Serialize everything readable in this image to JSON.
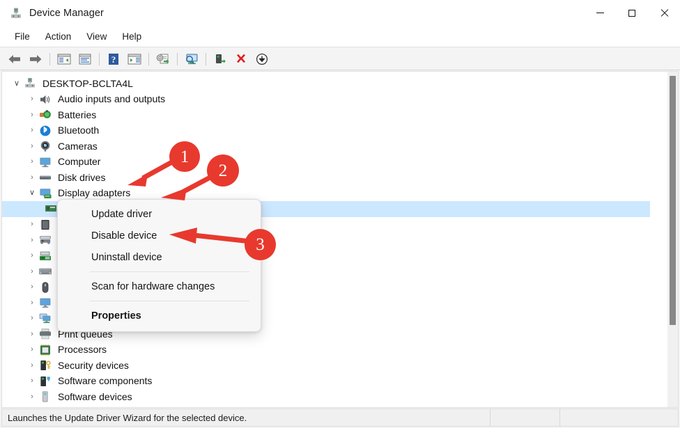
{
  "window": {
    "title": "Device Manager",
    "icon": "device-manager-icon",
    "controls": {
      "minimize": "Minimize",
      "maximize": "Maximize",
      "close": "Close"
    }
  },
  "menubar": {
    "items": [
      {
        "label": "File"
      },
      {
        "label": "Action"
      },
      {
        "label": "View"
      },
      {
        "label": "Help"
      }
    ]
  },
  "toolbar": {
    "buttons": [
      {
        "name": "back-icon",
        "tooltip": "Back"
      },
      {
        "name": "forward-icon",
        "tooltip": "Forward"
      },
      {
        "name": "show-hide-console-tree-icon",
        "tooltip": "Show/Hide console tree"
      },
      {
        "name": "properties-icon",
        "tooltip": "Properties"
      },
      {
        "name": "help-icon",
        "tooltip": "Help"
      },
      {
        "name": "show-hide-action-pane-icon",
        "tooltip": "Show/Hide Action pane"
      },
      {
        "name": "update-driver-icon",
        "tooltip": "Update driver"
      },
      {
        "name": "scan-for-hardware-changes-icon",
        "tooltip": "Scan for hardware changes"
      },
      {
        "name": "enable-device-icon",
        "tooltip": "Enable device"
      },
      {
        "name": "uninstall-device-icon",
        "tooltip": "Uninstall device"
      },
      {
        "name": "disable-device-icon",
        "tooltip": "Disable device"
      }
    ]
  },
  "tree": {
    "root": {
      "label": "DESKTOP-BCLTA4L",
      "icon": "computer-root-icon",
      "expanded": true,
      "chevron": "∨"
    },
    "items": [
      {
        "label": "Audio inputs and outputs",
        "icon": "speaker-icon",
        "expanded": false,
        "selected": false
      },
      {
        "label": "Batteries",
        "icon": "battery-icon",
        "expanded": false,
        "selected": false
      },
      {
        "label": "Bluetooth",
        "icon": "bluetooth-icon",
        "expanded": false,
        "selected": false
      },
      {
        "label": "Cameras",
        "icon": "camera-icon",
        "expanded": false,
        "selected": false
      },
      {
        "label": "Computer",
        "icon": "monitor-icon",
        "expanded": false,
        "selected": false
      },
      {
        "label": "Disk drives",
        "icon": "disk-drive-icon",
        "expanded": false,
        "selected": false
      },
      {
        "label": "Display adapters",
        "icon": "display-adapter-icon",
        "expanded": true,
        "selected": false
      },
      {
        "label": "",
        "icon": "graphics-card-icon",
        "expanded": false,
        "selected": true
      },
      {
        "label": "",
        "icon": "firmware-icon",
        "expanded": false,
        "selected": false
      },
      {
        "label": "",
        "icon": "game-controller-icon",
        "expanded": false,
        "selected": false
      },
      {
        "label": "",
        "icon": "ide-controller-icon",
        "expanded": false,
        "selected": false
      },
      {
        "label": "",
        "icon": "keyboard-icon",
        "expanded": false,
        "selected": false
      },
      {
        "label": "",
        "icon": "mouse-icon",
        "expanded": false,
        "selected": false
      },
      {
        "label": "",
        "icon": "monitor-icon",
        "expanded": false,
        "selected": false
      },
      {
        "label": "Network adapters",
        "icon": "network-adapter-icon",
        "expanded": false,
        "selected": false
      },
      {
        "label": "Print queues",
        "icon": "printer-icon",
        "expanded": false,
        "selected": false
      },
      {
        "label": "Processors",
        "icon": "processor-icon",
        "expanded": false,
        "selected": false
      },
      {
        "label": "Security devices",
        "icon": "security-device-icon",
        "expanded": false,
        "selected": false
      },
      {
        "label": "Software components",
        "icon": "software-component-icon",
        "expanded": false,
        "selected": false
      },
      {
        "label": "Software devices",
        "icon": "software-device-icon",
        "expanded": false,
        "selected": false
      }
    ],
    "chevron_collapsed": "›",
    "chevron_expanded": "∨"
  },
  "context_menu": {
    "items": [
      {
        "label": "Update driver",
        "bold": false,
        "separator_after": false
      },
      {
        "label": "Disable device",
        "bold": false,
        "separator_after": false
      },
      {
        "label": "Uninstall device",
        "bold": false,
        "separator_after": true
      },
      {
        "label": "Scan for hardware changes",
        "bold": false,
        "separator_after": true
      },
      {
        "label": "Properties",
        "bold": true,
        "separator_after": false
      }
    ]
  },
  "statusbar": {
    "message": "Launches the Update Driver Wizard for the selected device.",
    "cell2": "",
    "cell3": ""
  },
  "annotations": {
    "accent_color": "#e8392e",
    "badges": [
      {
        "label": "1"
      },
      {
        "label": "2"
      },
      {
        "label": "3"
      }
    ]
  }
}
